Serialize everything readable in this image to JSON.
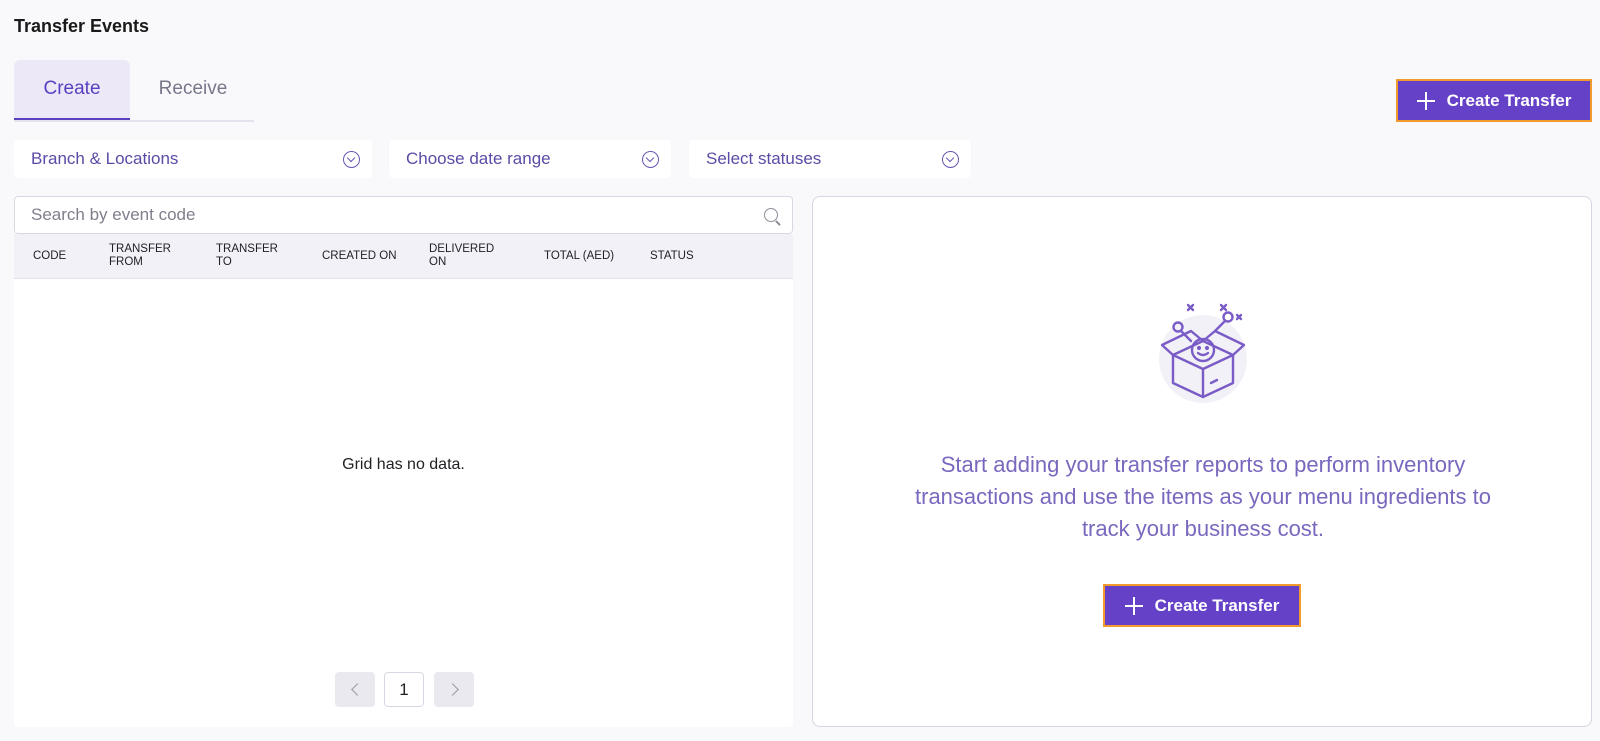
{
  "page": {
    "title": "Transfer Events"
  },
  "tabs": [
    {
      "label": "Create",
      "active": true
    },
    {
      "label": "Receive",
      "active": false
    }
  ],
  "actions": {
    "create_transfer_label": "Create Transfer"
  },
  "filters": {
    "branch": "Branch & Locations",
    "date_range": "Choose date range",
    "statuses": "Select statuses"
  },
  "search": {
    "placeholder": "Search by event code"
  },
  "grid": {
    "columns": [
      "CODE",
      "TRANSFER FROM",
      "TRANSFER TO",
      "CREATED ON",
      "DELIVERED ON",
      "TOTAL (AED)",
      "STATUS"
    ],
    "empty_message": "Grid has no data.",
    "pagination": {
      "current_page": "1"
    }
  },
  "empty_state": {
    "message": "Start adding your transfer reports to perform inventory transactions and use the items as your menu ingredients to track your business cost.",
    "button_label": "Create Transfer"
  },
  "colors": {
    "primary": "#6541c8",
    "button_outline": "#f39a2e",
    "accent_text": "#7a67be",
    "background": "#f9f9fc"
  },
  "icons": [
    "plus-icon",
    "chevron-down-icon",
    "search-icon",
    "chevron-left-icon",
    "chevron-right-icon",
    "empty-box-illustration"
  ]
}
